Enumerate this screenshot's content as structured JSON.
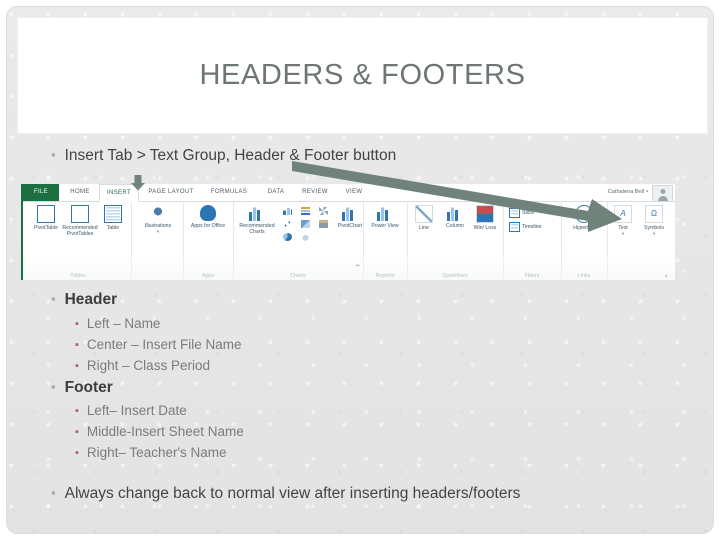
{
  "slide": {
    "title": "HEADERS & FOOTERS",
    "title_color": "#6d7672",
    "background_color": "#e8e8e8",
    "bullets": [
      {
        "level": 1,
        "text": "Insert Tab > Text Group, Header & Footer button",
        "bold": false
      },
      {
        "level": 1,
        "text": "Header",
        "bold": true
      },
      {
        "level": 2,
        "text": "Left – Name"
      },
      {
        "level": 2,
        "text": "Center – Insert File Name"
      },
      {
        "level": 2,
        "text": "Right – Class Period"
      },
      {
        "level": 1,
        "text": "Footer",
        "bold": true
      },
      {
        "level": 2,
        "text": "Left– Insert Date"
      },
      {
        "level": 2,
        "text": "Middle-Insert Sheet Name"
      },
      {
        "level": 2,
        "text": "Right– Teacher's Name"
      },
      {
        "level": 1,
        "text": "Always change back to normal view after inserting headers/footers",
        "bold": false
      }
    ],
    "annotations": {
      "arrow_color": "#6f837b",
      "down_arrow_name": "down-arrow-to-insert-tab",
      "diagonal_arrow_name": "diagonal-arrow-to-text-group"
    }
  },
  "excel": {
    "account_name": "Cathalena Bell",
    "account_caret": "‣",
    "tabs": [
      {
        "label": "FILE",
        "active": false,
        "style": "file"
      },
      {
        "label": "HOME",
        "active": false
      },
      {
        "label": "INSERT",
        "active": true
      },
      {
        "label": "PAGE LAYOUT",
        "active": false
      },
      {
        "label": "FORMULAS",
        "active": false
      },
      {
        "label": "DATA",
        "active": false
      },
      {
        "label": "REVIEW",
        "active": false
      },
      {
        "label": "VIEW",
        "active": false
      }
    ],
    "groups": [
      {
        "name": "Tables",
        "buttons": [
          "PivotTable",
          "Recommended PivotTables",
          "Table"
        ]
      },
      {
        "name": "",
        "buttons": [
          "Illustrations"
        ]
      },
      {
        "name": "Apps",
        "buttons": [
          "Apps for Office"
        ]
      },
      {
        "name": "Charts",
        "buttons": [
          "Recommended Charts",
          "PivotChart"
        ]
      },
      {
        "name": "Reports",
        "buttons": [
          "Power View"
        ]
      },
      {
        "name": "Sparklines",
        "buttons": [
          "Line",
          "Column",
          "Win/Loss"
        ]
      },
      {
        "name": "Filters",
        "buttons": [
          "Slicer",
          "Timeline"
        ]
      },
      {
        "name": "Links",
        "buttons": [
          "Hyperlink"
        ]
      },
      {
        "name": "",
        "buttons": [
          "Text",
          "Symbols"
        ]
      }
    ],
    "labels": {
      "pivottable": "PivotTable",
      "recommended_pivottables": "Recommended PivotTables",
      "table": "Table",
      "illustrations": "Illustrations",
      "apps_for_office": "Apps for Office",
      "recommended_charts": "Recommended Charts",
      "pivotchart": "PivotChart",
      "power_view": "Power View",
      "line": "Line",
      "column": "Column",
      "win_loss": "Win/ Loss",
      "slicer": "Slicer",
      "timeline": "Timeline",
      "hyperlink": "Hyperlink",
      "text": "Text",
      "symbols": "Symbols"
    },
    "group_labels": {
      "tables": "Tables",
      "apps": "Apps",
      "charts": "Charts",
      "reports": "Reports",
      "sparklines": "Sparklines",
      "filters": "Filters",
      "links": "Links"
    },
    "glyphs": {
      "dropdown": "▾",
      "dialog_launcher": "⬌",
      "collapse": "▲"
    }
  }
}
